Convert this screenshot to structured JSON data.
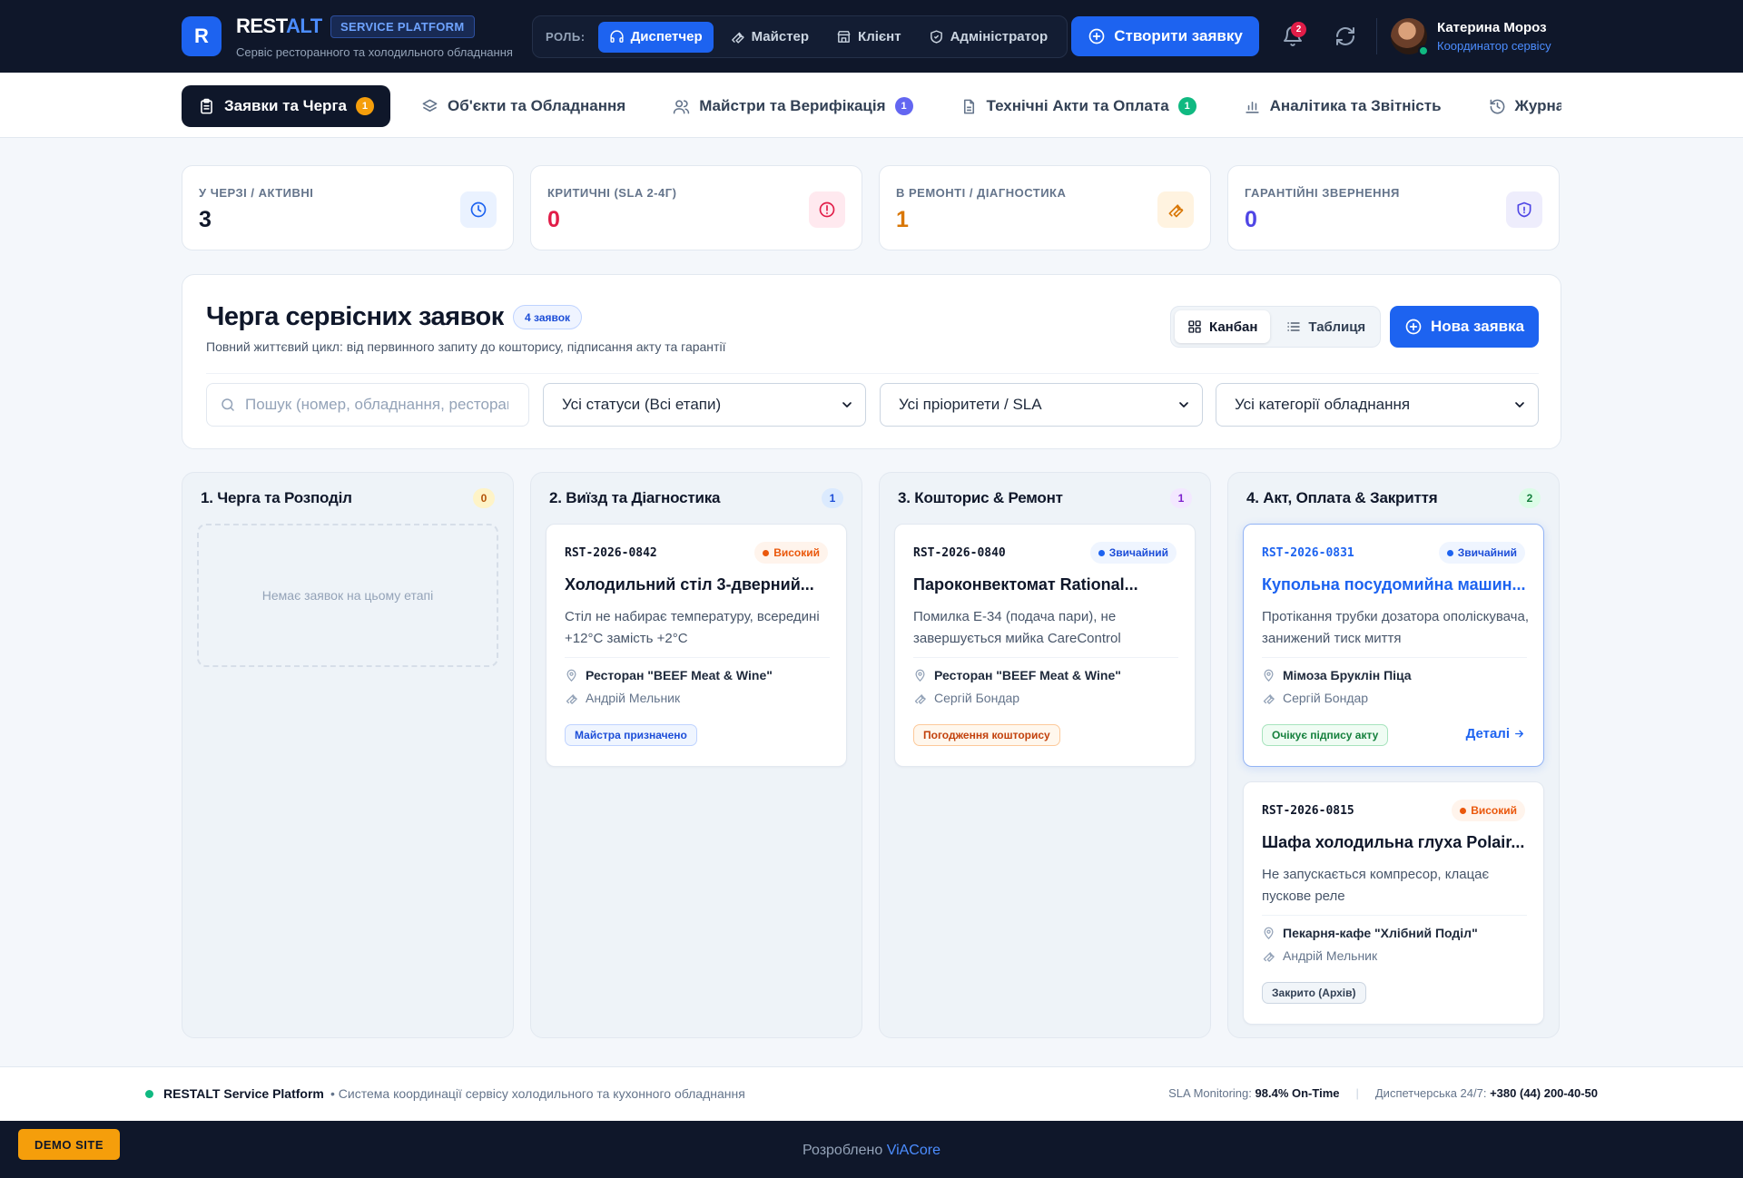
{
  "header": {
    "logo_letter": "R",
    "brand_main": "REST",
    "brand_accent": "ALT",
    "platform_badge": "SERVICE PLATFORM",
    "subtitle": "Сервіс ресторанного та холодильного обладнання",
    "role_label": "РОЛЬ:",
    "roles": [
      {
        "label": "Диспетчер",
        "icon": "headset-icon",
        "active": true
      },
      {
        "label": "Майстер",
        "icon": "wrench-icon",
        "active": false
      },
      {
        "label": "Клієнт",
        "icon": "store-icon",
        "active": false
      },
      {
        "label": "Адміністратор",
        "icon": "shield-icon",
        "active": false
      }
    ],
    "create_button": "Створити заявку",
    "notifications_count": "2",
    "user_name": "Катерина Мороз",
    "user_role": "Координатор сервісу"
  },
  "tabs": [
    {
      "label": "Заявки та Черга",
      "badge": "1",
      "badge_color": "#f59e0b",
      "icon": "clipboard-icon",
      "active": true
    },
    {
      "label": "Об'єкти та Обладнання",
      "badge": "",
      "icon": "layers-icon",
      "active": false
    },
    {
      "label": "Майстри та Верифікація",
      "badge": "1",
      "badge_color": "#6366f1",
      "icon": "users-icon",
      "active": false
    },
    {
      "label": "Технічні Акти та Оплата",
      "badge": "1",
      "badge_color": "#10b981",
      "icon": "document-icon",
      "active": false
    },
    {
      "label": "Аналітика та Звітність",
      "badge": "",
      "icon": "bar-chart-icon",
      "active": false
    },
    {
      "label": "Журнал аудиту",
      "badge": "",
      "icon": "history-icon",
      "active": false
    }
  ],
  "stats": [
    {
      "label": "У ЧЕРЗІ / АКТИВНІ",
      "value": "3",
      "color": "#0f172a",
      "icon": "clock-icon",
      "icon_bg": "#eaf2ff",
      "icon_color": "#1d63f0"
    },
    {
      "label": "КРИТИЧНІ (SLA 2-4Г)",
      "value": "0",
      "color": "#e11d48",
      "icon": "alert-icon",
      "icon_bg": "#ffe9ef",
      "icon_color": "#e11d48"
    },
    {
      "label": "В РЕМОНТІ / ДІАГНОСТИКА",
      "value": "1",
      "color": "#d97706",
      "icon": "wrench-icon",
      "icon_bg": "#fff3e0",
      "icon_color": "#d97706"
    },
    {
      "label": "ГАРАНТІЙНІ ЗВЕРНЕННЯ",
      "value": "0",
      "color": "#4f46e5",
      "icon": "shield-icon",
      "icon_bg": "#eeedfc",
      "icon_color": "#4f46e5"
    }
  ],
  "queue": {
    "title": "Черга сервісних заявок",
    "count": "4 заявок",
    "subtitle": "Повний життєвий цикл: від первинного запиту до кошторису, підписання акту та гарантії",
    "view_kanban": "Канбан",
    "view_table": "Таблиця",
    "new_button": "Нова заявка",
    "search_placeholder": "Пошук (номер, обладнання, ресторан)",
    "filter_status": "Усі статуси (Всі етапи)",
    "filter_priority": "Усі пріоритети / SLA",
    "filter_category": "Усі категорії обладнання"
  },
  "columns": [
    {
      "title": "1. Черга та Розподіл",
      "count": "0",
      "count_bg": "#fef3c7",
      "count_color": "#b45309",
      "empty_text": "Немає заявок на цьому етапі",
      "cards": []
    },
    {
      "title": "2. Виїзд та Діагностика",
      "count": "1",
      "count_bg": "#dbeafe",
      "count_color": "#1d4ed8",
      "cards": [
        {
          "id": "RST-2026-0842",
          "priority": "Високий",
          "priority_kind": "high",
          "title": "Холодильний стіл 3-дверний...",
          "desc": "Стіл не набирає температуру, всередині +12°C замість +2°C",
          "location": "Ресторан \"BEEF Meat & Wine\"",
          "tech": "Андрій Мельник",
          "status": "Майстра призначено",
          "status_kind": "blue"
        }
      ]
    },
    {
      "title": "3. Кошторис & Ремонт",
      "count": "1",
      "count_bg": "#f3e8ff",
      "count_color": "#7e22ce",
      "cards": [
        {
          "id": "RST-2026-0840",
          "priority": "Звичайний",
          "priority_kind": "normal",
          "title": "Пароконвектомат Rational...",
          "desc": "Помилка E-34 (подача пари), не завершується мийка CareControl",
          "location": "Ресторан \"BEEF Meat & Wine\"",
          "tech": "Сергій Бондар",
          "status": "Погодження кошторису",
          "status_kind": "orange"
        }
      ]
    },
    {
      "title": "4. Акт, Оплата & Закриття",
      "count": "2",
      "count_bg": "#dcfce7",
      "count_color": "#15803d",
      "cards": [
        {
          "id": "RST-2026-0831",
          "priority": "Звичайний",
          "priority_kind": "normal",
          "title": "Купольна посудомийна машин...",
          "desc": "Протікання трубки дозатора ополіскувача, занижений тиск миття",
          "location": "Мімоза Бруклін Піца",
          "tech": "Сергій Бондар",
          "status": "Очікує підпису акту",
          "status_kind": "green",
          "details": "Деталі",
          "selected": true
        },
        {
          "id": "RST-2026-0815",
          "priority": "Високий",
          "priority_kind": "high",
          "title": "Шафа холодильна глуха Polair...",
          "desc": "Не запускається компресор, клацає пускове реле",
          "location": "Пекарня-кафе \"Хлібний Поділ\"",
          "tech": "Андрій Мельник",
          "status": "Закрито (Архів)",
          "status_kind": "gray"
        }
      ]
    }
  ],
  "footer": {
    "brand": "RESTALT Service Platform",
    "desc": "• Система координації сервісу холодильного та кухонного обладнання",
    "sla_label": "SLA Monitoring:",
    "sla_value": "98.4% On-Time",
    "separator": "|",
    "dispatch_label": "Диспетчерська 24/7:",
    "dispatch_phone": "+380 (44) 200-40-50",
    "demo": "DEMO SITE",
    "credits_prefix": "Розроблено",
    "credits_company": "ViACore"
  }
}
